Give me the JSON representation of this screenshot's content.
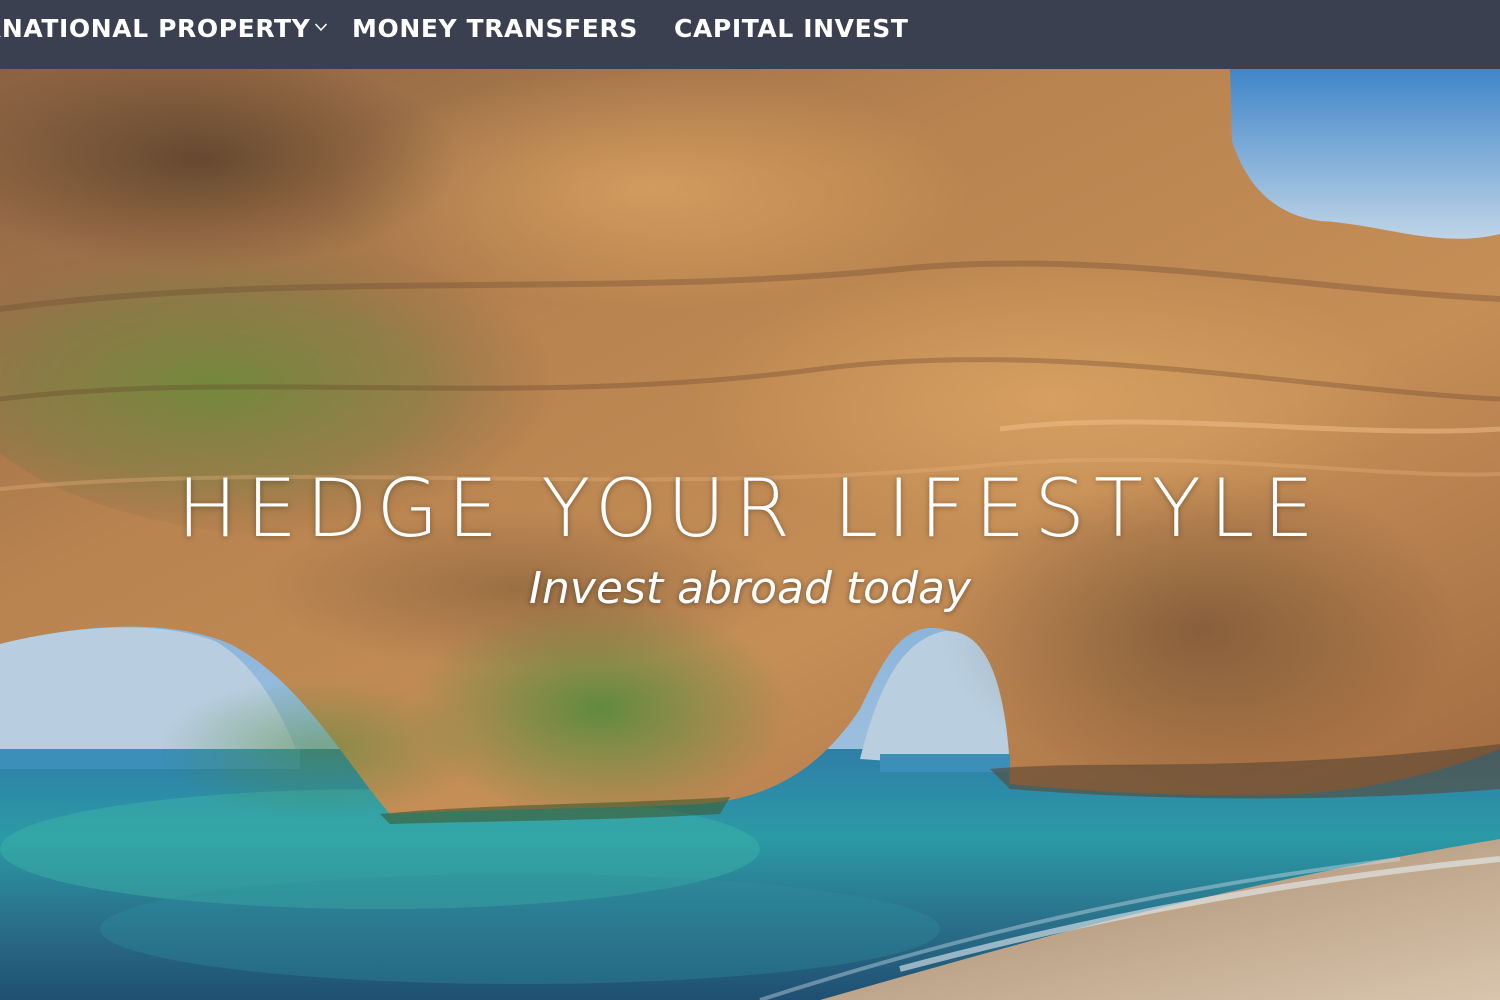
{
  "nav": {
    "items": [
      {
        "label": "RNATIONAL PROPERTY",
        "has_dropdown": true
      },
      {
        "label": "MONEY TRANSFERS",
        "has_dropdown": false
      },
      {
        "label": "CAPITAL INVEST",
        "has_dropdown": false
      }
    ],
    "dropdown_icon": "chevron-down-icon",
    "background": "#3a4050",
    "text_color": "#ffffff"
  },
  "hero": {
    "title": "HEDGE YOUR LIFESTYLE",
    "subtitle": "Invest abroad today",
    "text_color": "#ffffff"
  }
}
